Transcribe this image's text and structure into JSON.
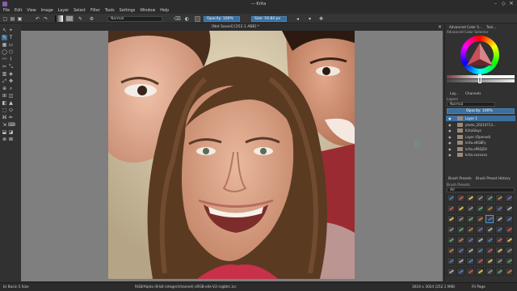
{
  "window": {
    "title": "— Krita"
  },
  "menu": [
    "File",
    "Edit",
    "View",
    "Image",
    "Layer",
    "Select",
    "Filter",
    "Tools",
    "Settings",
    "Window",
    "Help"
  ],
  "toolbar": {
    "blend_mode": "Normal",
    "opacity": "Opacity: 100%",
    "size": "Size: 19.84 px"
  },
  "canvas": {
    "tab": "[Not Saved] [252.1 ABB] *"
  },
  "right": {
    "color_tabs": [
      "Advanced Color S...",
      "Tool..."
    ],
    "color_header": "Advanced Color Selector",
    "panel_tabs": [
      "Lay...",
      "Channels"
    ],
    "layers_header": "Layers",
    "layer_blend": "Normal",
    "layer_opacity": "Opacity: 100%",
    "layers": [
      "Layer 1",
      "photo_20210713...",
      "KritaSlays",
      "Layer (Opened)",
      "krita.eKGBFy",
      "krita.ePKQZH",
      "krita.xxxxxxx"
    ],
    "brush_tabs": [
      "Brush Presets",
      "Brush Preset History"
    ],
    "brush_header": "Brush Presets",
    "brush_filter": "All"
  },
  "status": {
    "left": "b) Basic-5 Size",
    "center": "RGB/Alpha (8-bit integer/channel) sRGB-elle-V2-srgbtrc.icc",
    "dims": "3024 x 3024 (252.1 MiB)",
    "fit": "Fit Page"
  },
  "colors": {
    "accent": "#3b6f9e",
    "bg": "#313131",
    "canvas": "#7f7f7f"
  }
}
